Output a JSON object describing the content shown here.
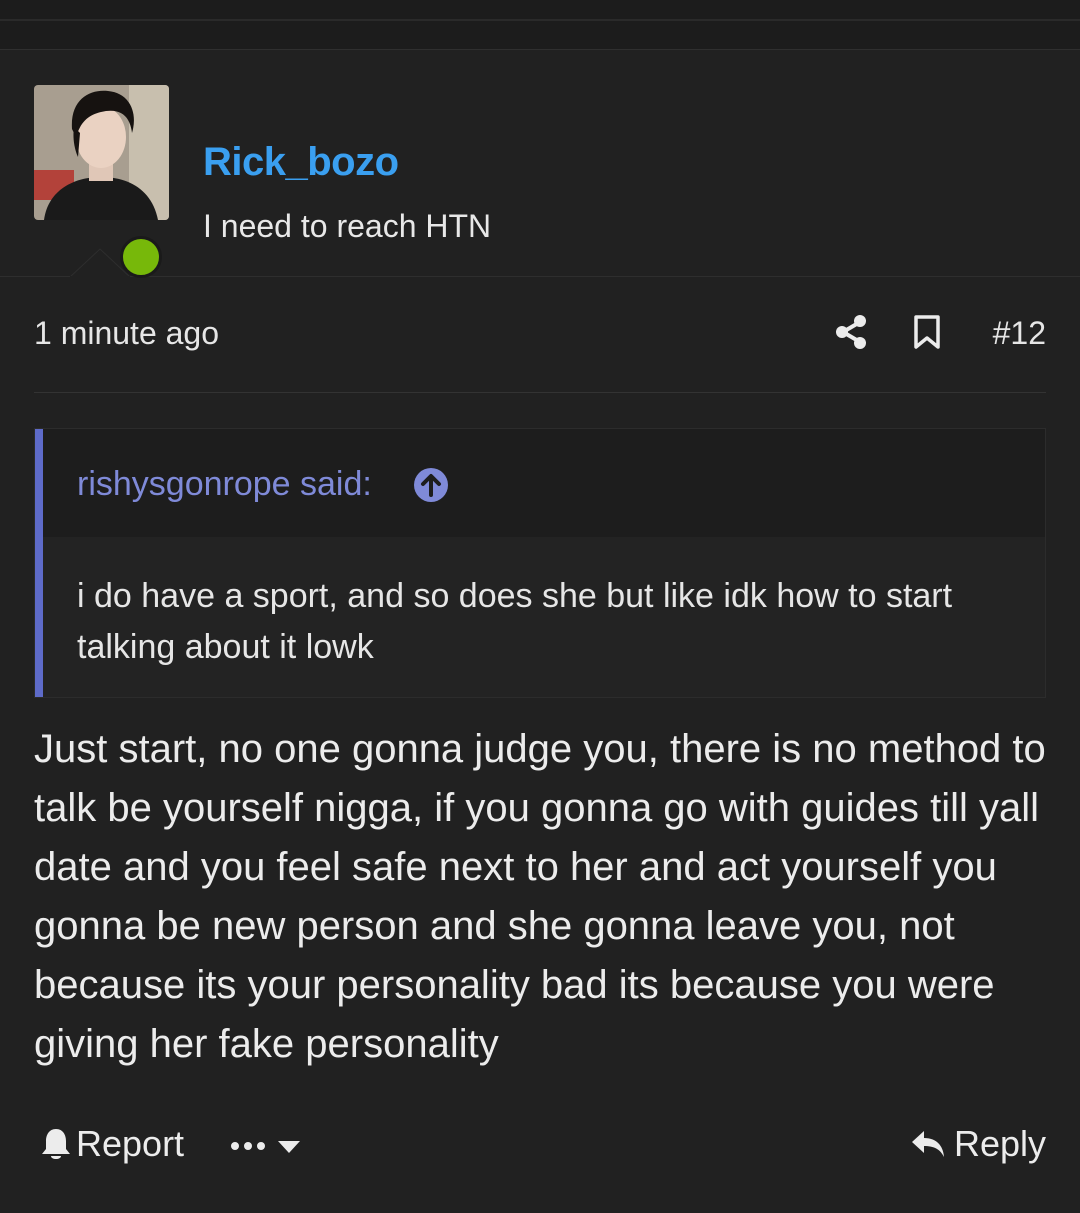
{
  "post": {
    "author": {
      "username": "Rick_bozo",
      "user_title": "I need to reach HTN",
      "online": true
    },
    "timestamp": "1 minute ago",
    "post_number": "#12",
    "quote": {
      "author_label": "rishysgonrope said:",
      "text": "i do have a sport, and so does she but like idk how to start talking about it lowk"
    },
    "message": "Just start, no one gonna judge you, there is no method to talk be yourself nigga, if you gonna go with guides till yall date and you feel safe next to her and act yourself you gonna be new person and she gonna leave you, not because its your personality bad its because you were giving her fake personality",
    "actions": {
      "report_label": "Report",
      "reply_label": "Reply"
    }
  },
  "icons": [
    "share-icon",
    "bookmark-icon",
    "arrow-up-circle-icon",
    "bell-icon",
    "more-dots-icon",
    "caret-down-icon",
    "reply-arrow-icon"
  ],
  "colors": {
    "background": "#212121",
    "username": "#3a9ff0",
    "quote_accent": "#5e6bc9",
    "quote_author": "#7f8ad8",
    "online": "#77b80a"
  }
}
